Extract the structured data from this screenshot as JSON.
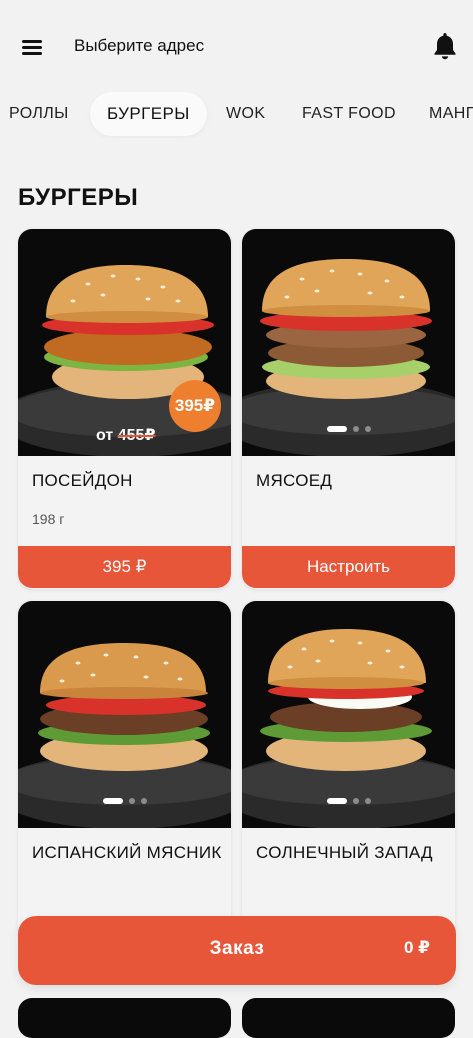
{
  "header": {
    "address_label": "Выберите адрес",
    "icons": {
      "menu": "hamburger-menu-icon",
      "notifications": "bell-icon"
    }
  },
  "tabs": [
    {
      "label": "РОЛЛЫ",
      "active": false
    },
    {
      "label": "БУРГЕРЫ",
      "active": true
    },
    {
      "label": "WOK",
      "active": false
    },
    {
      "label": "FAST FOOD",
      "active": false
    },
    {
      "label": "МАНГ",
      "active": false
    }
  ],
  "section": {
    "title": "БУРГЕРЫ"
  },
  "products": [
    {
      "name": "ПОСЕЙДОН",
      "weight": "198 г",
      "button_label": "395 ₽",
      "badge_price": "395₽",
      "old_price_prefix": "от",
      "old_price": "455₽",
      "image": "fried-chicken-burger"
    },
    {
      "name": "МЯСОЕД",
      "weight": "",
      "button_label": "Настроить",
      "image": "double-patty-burger",
      "gallery": {
        "count": 3,
        "active_index": 0
      }
    },
    {
      "name": "ИСПАНСКИЙ МЯСНИК",
      "weight": "",
      "button_label": "",
      "image": "beef-bacon-burger",
      "gallery": {
        "count": 3,
        "active_index": 0
      }
    },
    {
      "name": "СОЛНЕЧНЫЙ ЗАПАД",
      "weight": "",
      "button_label": "",
      "image": "egg-burger",
      "gallery": {
        "count": 3,
        "active_index": 0
      }
    }
  ],
  "order_bar": {
    "label": "Заказ",
    "total": "0 ₽"
  },
  "colors": {
    "accent": "#e8563a",
    "badge": "#ee7f2e",
    "background": "#f2f2f2",
    "card_image_bg": "#0a0a0a"
  }
}
